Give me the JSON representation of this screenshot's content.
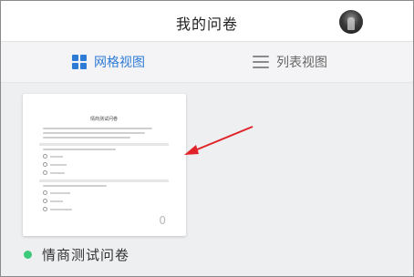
{
  "header": {
    "title": "我的问卷"
  },
  "tabs": [
    {
      "label": "网格视图",
      "icon": "grid-icon",
      "active": true
    },
    {
      "label": "列表视图",
      "icon": "list-icon",
      "active": false
    }
  ],
  "survey_card": {
    "preview_title": "情商测试问卷",
    "response_count": "0",
    "name": "情商测试问卷",
    "status_color": "#3cc97a"
  },
  "colors": {
    "accent": "#2e7bd6",
    "annotation_arrow": "#e0242a"
  }
}
